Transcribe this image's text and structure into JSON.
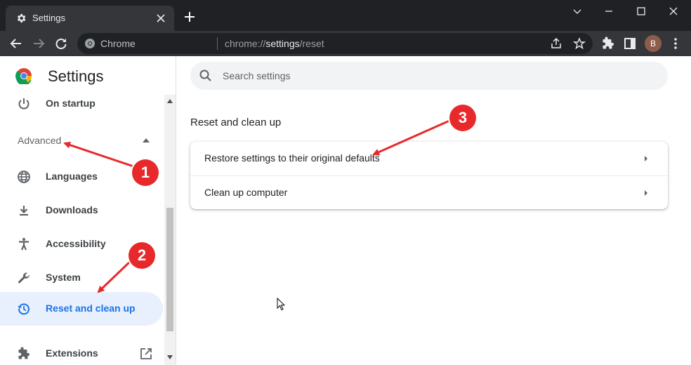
{
  "window": {
    "tab_title": "Settings",
    "minimize_icon": "minimize-icon",
    "maximize_icon": "maximize-icon",
    "close_icon": "close-icon"
  },
  "toolbar": {
    "site_chip": "Chrome",
    "url_prefix": "chrome://",
    "url_host": "settings",
    "url_path": "/reset",
    "avatar_initial": "B"
  },
  "settings": {
    "title": "Settings",
    "search_placeholder": "Search settings",
    "menu": {
      "on_startup": "On startup",
      "advanced": "Advanced",
      "languages": "Languages",
      "downloads": "Downloads",
      "accessibility": "Accessibility",
      "system": "System",
      "reset": "Reset and clean up",
      "extensions": "Extensions"
    },
    "section_title": "Reset and clean up",
    "rows": [
      {
        "label": "Restore settings to their original defaults"
      },
      {
        "label": "Clean up computer"
      }
    ]
  },
  "annotations": [
    {
      "number": "1"
    },
    {
      "number": "2"
    },
    {
      "number": "3"
    }
  ],
  "colors": {
    "accent": "#1a73e8",
    "active_bg": "#e8f0fe",
    "annotation": "#e8292b"
  }
}
